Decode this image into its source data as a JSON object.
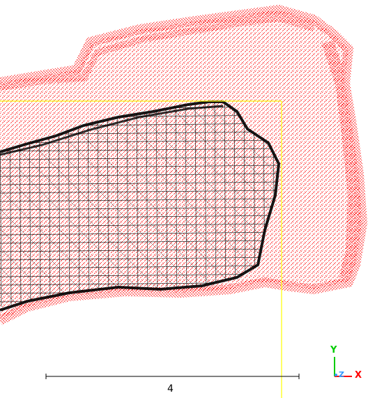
{
  "viewport": {
    "point_cloud_color": "#ff0000",
    "mesh_color": "#000000",
    "bbox_color": "#ffff00"
  },
  "scale_bar": {
    "label": "4"
  },
  "axes": {
    "y_label": "Y",
    "z_label": "Z",
    "x_label": "X",
    "y_color": "#00cc00",
    "z_color": "#3399ff",
    "x_color": "#ff0000"
  }
}
